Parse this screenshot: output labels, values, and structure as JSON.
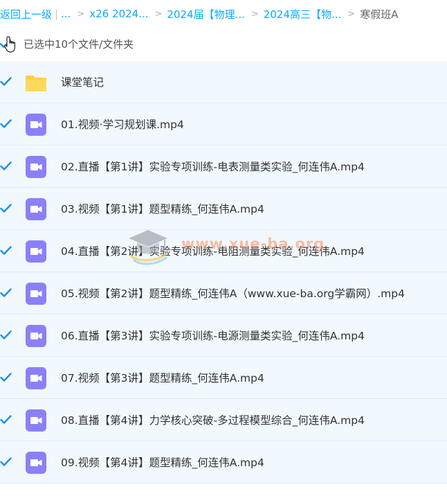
{
  "breadcrumb": {
    "back_label": "返回上一级",
    "separator": "|",
    "ellipsis": "...",
    "arrow": ">",
    "items": [
      "x26 2024...",
      "2024届【物理...",
      "2024高三【物..."
    ],
    "current": "寒假班A"
  },
  "selection": {
    "text": "已选中10个文件/文件夹"
  },
  "files": [
    {
      "name": "课堂笔记",
      "type": "folder",
      "checked": true
    },
    {
      "name": "01.视频·学习规划课.mp4",
      "type": "video",
      "checked": true
    },
    {
      "name": "02.直播【第1讲】实验专项训练-电表测量类实验_何连伟A.mp4",
      "type": "video",
      "checked": true
    },
    {
      "name": "03.视频【第1讲】题型精练_何连伟A.mp4",
      "type": "video",
      "checked": true
    },
    {
      "name": "04.直播【第2讲】实验专项训练-电阻测量类实验_何连伟A.mp4",
      "type": "video",
      "checked": true
    },
    {
      "name": "05.视频【第2讲】题型精练_何连伟A（www.xue-ba.org学霸网）.mp4",
      "type": "video",
      "checked": true
    },
    {
      "name": "06.直播【第3讲】实验专项训练-电源测量类实验_何连伟A.mp4",
      "type": "video",
      "checked": true
    },
    {
      "name": "07.视频【第3讲】题型精练_何连伟A.mp4",
      "type": "video",
      "checked": true
    },
    {
      "name": "08.直播【第4讲】力学核心突破-多过程模型综合_何连伟A.mp4",
      "type": "video",
      "checked": true
    },
    {
      "name": "09.视频【第4讲】题型精练_何连伟A.mp4",
      "type": "video",
      "checked": true
    }
  ],
  "watermark": {
    "text": "www.xue-ba.org"
  },
  "colors": {
    "link": "#09aaff",
    "check": "#1c8ef0",
    "row_bg": "#f1f9fe",
    "video_icon": "#8b80f9",
    "folder_icon": "#ffcf4a"
  }
}
